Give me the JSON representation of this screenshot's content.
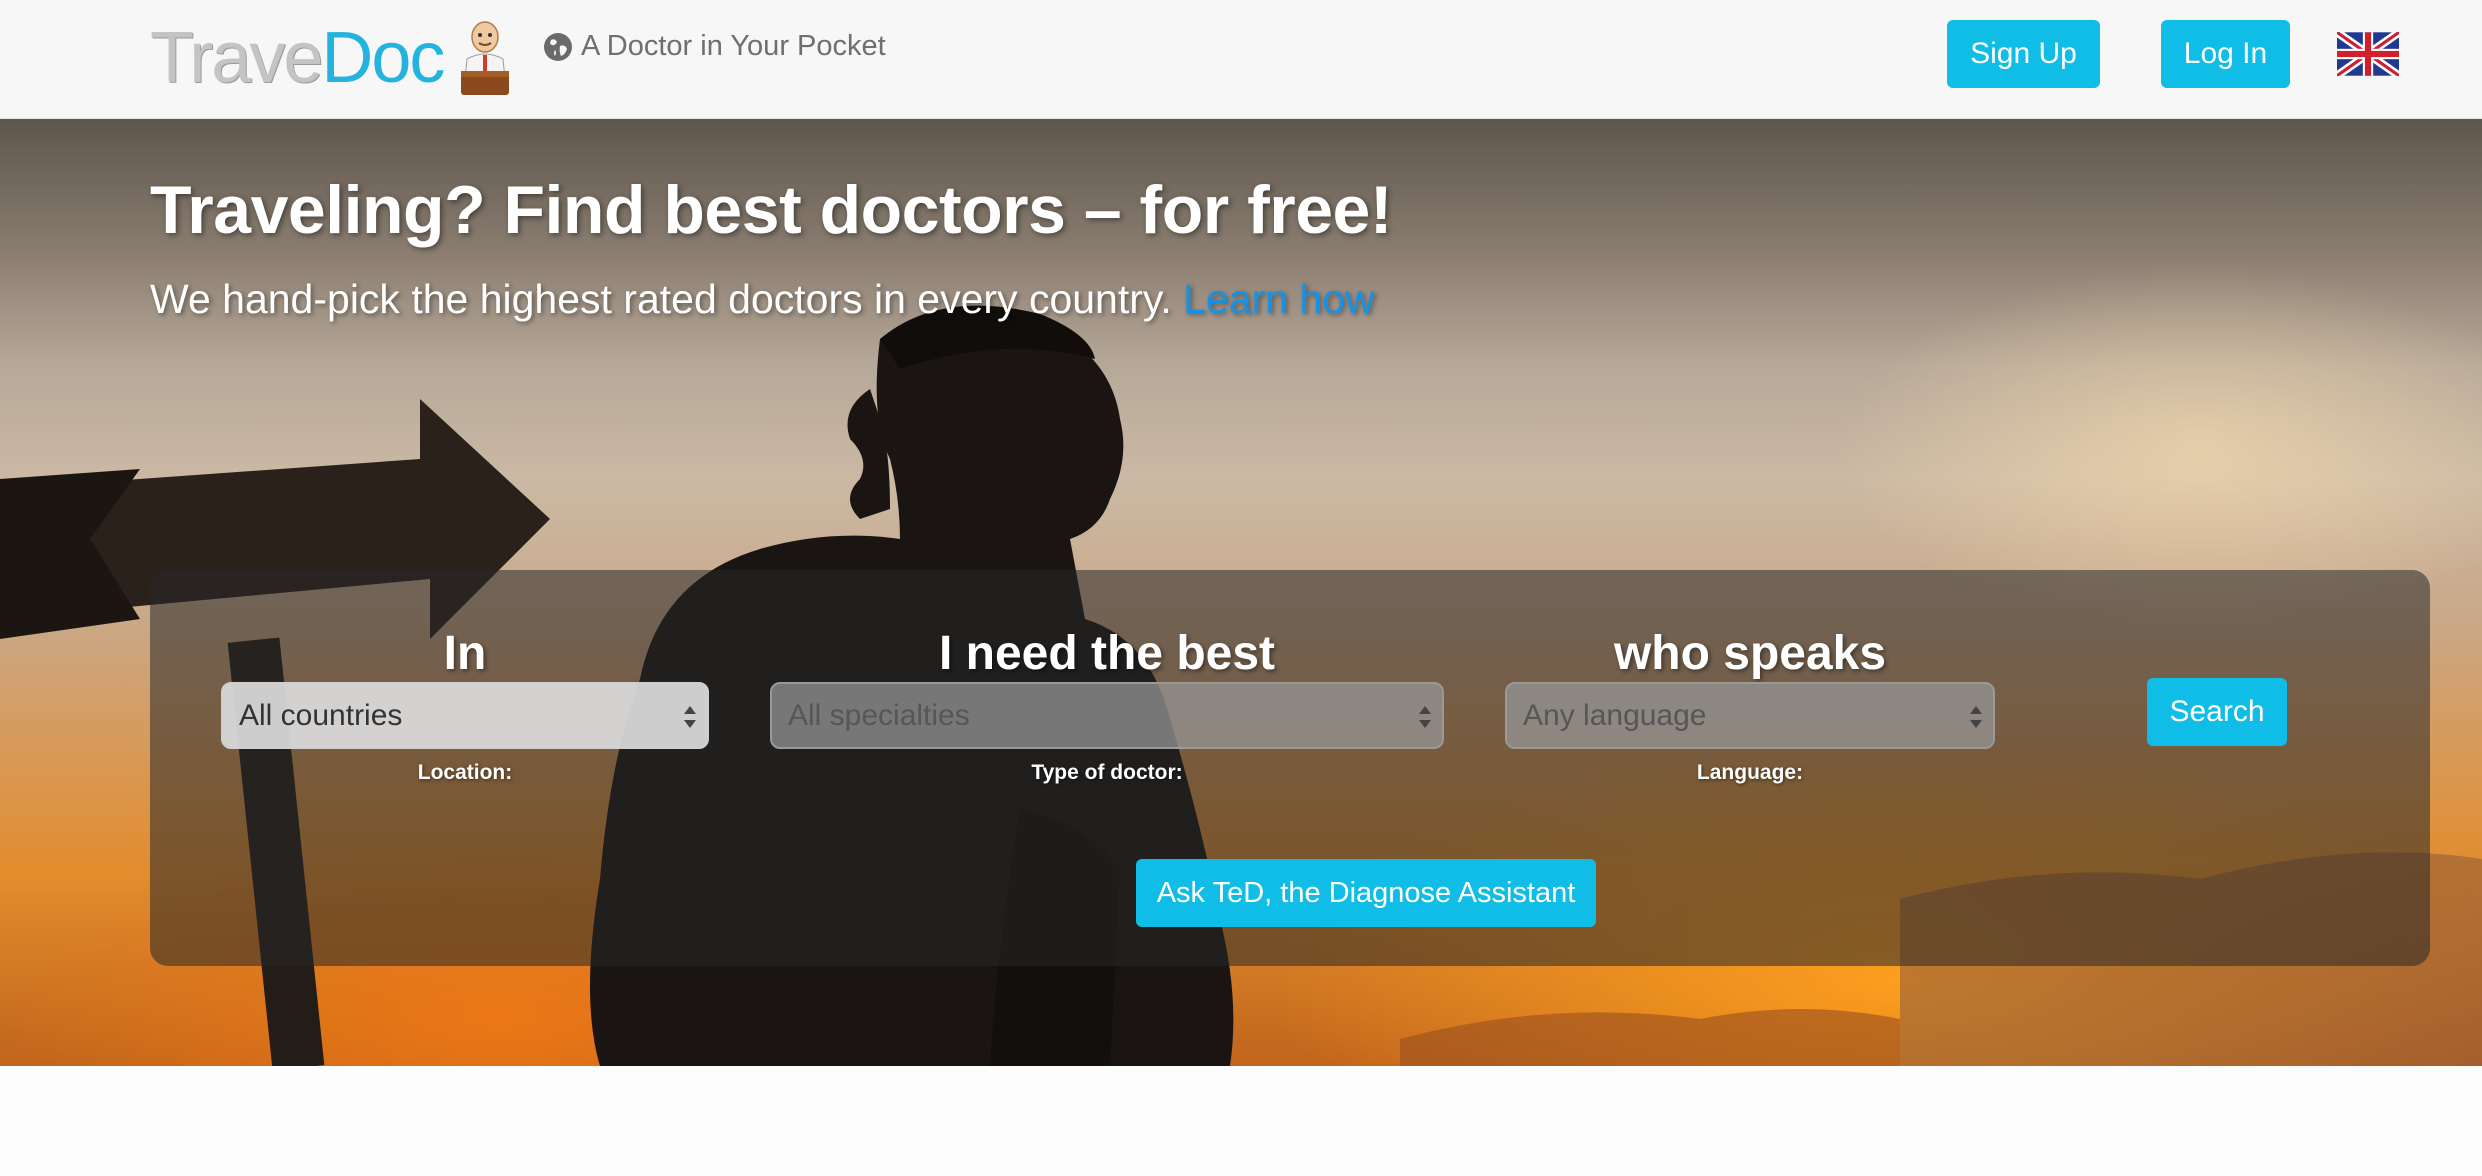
{
  "header": {
    "logo_part1": "Trave",
    "logo_part2": "Doc",
    "tagline": "A Doctor in Your Pocket",
    "signup_label": "Sign Up",
    "login_label": "Log In",
    "flag": "uk-flag-icon",
    "globe": "globe-icon"
  },
  "hero": {
    "title": "Traveling? Find best doctors – for free!",
    "subtitle": "We hand-pick the highest rated doctors in every country.",
    "learn_link": "Learn how"
  },
  "search": {
    "location": {
      "heading": "In",
      "value": "All countries",
      "label": "Location:"
    },
    "specialty": {
      "heading": "I need the best",
      "placeholder": "All specialties",
      "label": "Type of doctor:"
    },
    "language": {
      "heading": "who speaks",
      "placeholder": "Any language",
      "label": "Language:"
    },
    "search_label": "Search",
    "ted_label": "Ask TeD, the Diagnose Assistant"
  },
  "colors": {
    "accent": "#10bde6",
    "logo_doc": "#23b3de",
    "link": "#1592e6"
  }
}
